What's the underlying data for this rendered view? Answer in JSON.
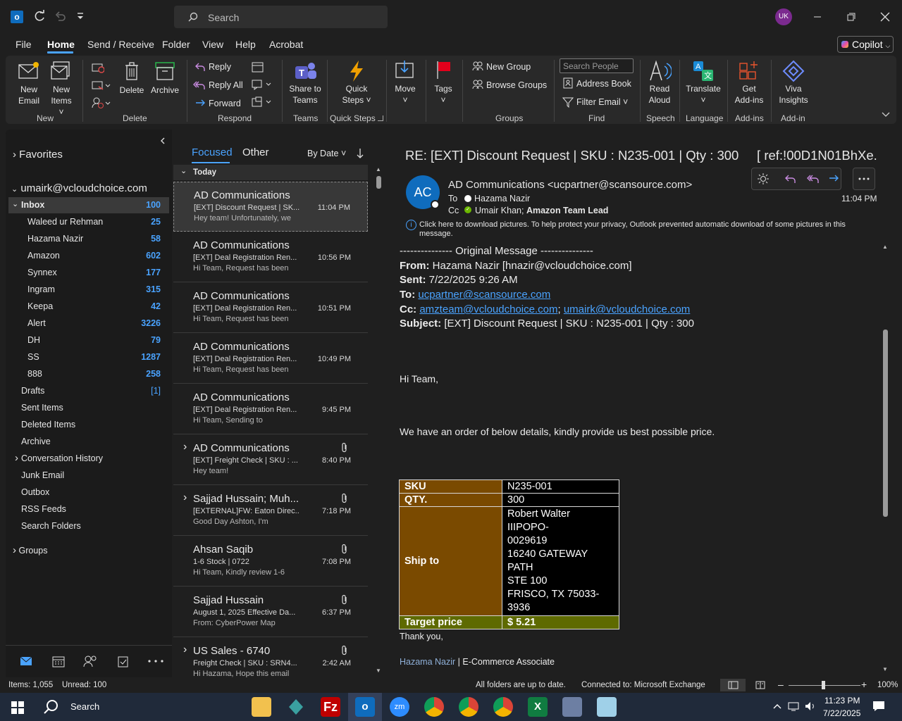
{
  "title_bar": {
    "search_placeholder": "Search",
    "avatar_initials": "UK"
  },
  "menu": [
    "File",
    "Home",
    "Send / Receive",
    "Folder",
    "View",
    "Help",
    "Acrobat"
  ],
  "copilot_label": "Copilot",
  "ribbon": {
    "new_email": [
      "New",
      "Email"
    ],
    "new_items": [
      "New",
      "Items"
    ],
    "delete": "Delete",
    "archive": "Archive",
    "reply": "Reply",
    "reply_all": "Reply All",
    "forward": "Forward",
    "share_teams": [
      "Share to",
      "Teams"
    ],
    "quick_steps": [
      "Quick",
      "Steps"
    ],
    "move": "Move",
    "tags": "Tags",
    "new_group": "New Group",
    "browse_groups": "Browse Groups",
    "search_people": "Search People",
    "address_book": "Address Book",
    "filter_email": "Filter Email",
    "read_aloud": [
      "Read",
      "Aloud"
    ],
    "translate": "Translate",
    "get_addins": [
      "Get",
      "Add-ins"
    ],
    "viva": [
      "Viva",
      "Insights"
    ],
    "groups": [
      "New",
      "Delete",
      "Respond",
      "Teams",
      "Quick Steps",
      "Groups",
      "Find",
      "Speech",
      "Language",
      "Add-ins",
      "Add-in"
    ]
  },
  "folders": {
    "favorites": "Favorites",
    "account": "umairk@vcloudchoice.com",
    "inbox": {
      "label": "Inbox",
      "count": "100"
    },
    "subfolders": [
      {
        "label": "Waleed ur Rehman",
        "count": "25"
      },
      {
        "label": "Hazama Nazir",
        "count": "58"
      },
      {
        "label": "Amazon",
        "count": "602"
      },
      {
        "label": "Synnex",
        "count": "177"
      },
      {
        "label": "Ingram",
        "count": "315"
      },
      {
        "label": "Keepa",
        "count": "42"
      },
      {
        "label": "Alert",
        "count": "3226"
      },
      {
        "label": "DH",
        "count": "79"
      },
      {
        "label": "SS",
        "count": "1287"
      },
      {
        "label": "888",
        "count": "258"
      }
    ],
    "drafts": {
      "label": "Drafts",
      "count": "[1]"
    },
    "others": [
      "Sent Items",
      "Deleted Items",
      "Archive",
      "Conversation History",
      "Junk Email",
      "Outbox",
      "RSS Feeds",
      "Search Folders"
    ],
    "groups": "Groups"
  },
  "list": {
    "tab_focused": "Focused",
    "tab_other": "Other",
    "sort": "By Date",
    "section": "Today",
    "items": [
      {
        "sender": "AD Communications",
        "subject": "[EXT] Discount Request | SK...",
        "preview": "Hey team!  Unfortunately, we",
        "time": "11:04 PM"
      },
      {
        "sender": "AD Communications",
        "subject": "[EXT] Deal Registration Ren...",
        "preview": "Hi Team,   Request has been",
        "time": "10:56 PM"
      },
      {
        "sender": "AD Communications",
        "subject": "[EXT] Deal Registration Ren...",
        "preview": "Hi Team,   Request has been",
        "time": "10:51 PM"
      },
      {
        "sender": "AD Communications",
        "subject": "[EXT] Deal Registration Ren...",
        "preview": "Hi Team,   Request has been",
        "time": "10:49 PM"
      },
      {
        "sender": "AD Communications",
        "subject": "[EXT] Deal Registration Ren...",
        "preview": "Hi Team,   Sending to",
        "time": "9:45 PM"
      },
      {
        "sender": "AD Communications",
        "subject": "[EXT] Freight Check | SKU : ...",
        "preview": "Hey team!",
        "time": "8:40 PM"
      },
      {
        "sender": "Sajjad Hussain;  Muh...",
        "subject": "[EXTERNAL]FW: Eaton Direc...",
        "preview": "Good Day Ashton,   I'm",
        "time": "7:18 PM"
      },
      {
        "sender": "Ahsan Saqib",
        "subject": "1-6 Stock | 0722",
        "preview": "Hi Team,  Kindly review 1-6",
        "time": "7:08 PM"
      },
      {
        "sender": "Sajjad Hussain",
        "subject": "August 1, 2025 Effective Da...",
        "preview": "From: CyberPower Map",
        "time": "6:37 PM"
      },
      {
        "sender": "US Sales - 6740",
        "subject": "Freight Check | SKU : SRN4...",
        "preview": "Hi Hazama,  Hope this email",
        "time": "2:42 AM"
      }
    ]
  },
  "message": {
    "subject": "RE: [EXT] Discount Request | SKU : N235-001 | Qty : 300     [ ref:!00D1N01BhXe.!...",
    "avatar": "AC",
    "from": "AD Communications <ucpartner@scansource.com>",
    "to_label": "To",
    "to": "Hazama Nazir",
    "cc_label": "Cc",
    "cc_name": "Umair Khan;",
    "cc_bold": "Amazon Team Lead",
    "time": "11:04 PM",
    "info": "Click here to download pictures. To help protect your privacy, Outlook prevented automatic download of some pictures in this message.",
    "orig": "--------------- Original Message ---------------",
    "from_label": "From:",
    "from_val": "Hazama Nazir [hnazir@vcloudchoice.com]",
    "sent_label": "Sent:",
    "sent_val": "7/22/2025 9:26 AM",
    "to2_label": "To:",
    "to2_val": "ucpartner@scansource.com",
    "cc2_label": "Cc:",
    "cc2_val1": "amzteam@vcloudchoice.com",
    "cc2_val2": "umairk@vcloudchoice.com",
    "subj_label": "Subject:",
    "subj_val": "[EXT] Discount Request | SKU : N235-001 | Qty : 300",
    "greeting": "Hi Team,",
    "body": "We have an order of below details, kindly provide us best possible price.",
    "table": {
      "sku_k": "SKU",
      "sku_v": "N235-001",
      "qty_k": "QTY.",
      "qty_v": "300",
      "ship_k": "Ship to",
      "ship_v": [
        "Robert Walter IIIPOPO-",
        "0029619",
        "16240 GATEWAY PATH",
        "STE 100",
        "FRISCO, TX 75033-3936"
      ],
      "tp_k": "Target price",
      "tp_v": "$ 5.21"
    },
    "thanks": "Thank you,",
    "sig_name": "Hazama Nazir",
    "sig_title": " | E-Commerce Associate"
  },
  "status": {
    "items": "Items: 1,055",
    "unread": "Unread: 100",
    "sync": "All folders are up to date.",
    "conn": "Connected to: Microsoft Exchange",
    "zoom": "100%"
  },
  "taskbar": {
    "search": "Search",
    "time": "11:23 PM",
    "date": "7/22/2025"
  }
}
